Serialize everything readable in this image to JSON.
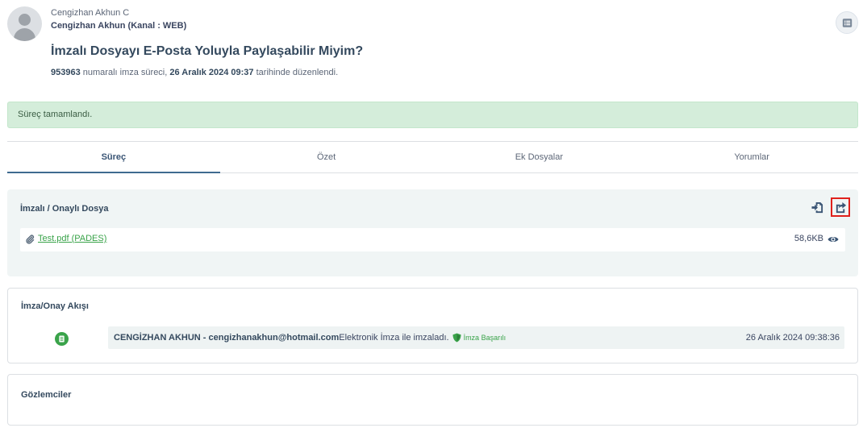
{
  "user": {
    "name": "Cengizhan Akhun C",
    "channel": "Cengizhan Akhun (Kanal : WEB)"
  },
  "title": "İmzalı Dosyayı E-Posta Yoluyla Paylaşabilir Miyim?",
  "meta": {
    "process_id": "953963",
    "text1": " numaralı imza süreci, ",
    "date": "26 Aralık 2024 09:37",
    "text2": " tarihinde düzenlendi."
  },
  "alert": "Süreç tamamlandı.",
  "tabs": [
    {
      "label": "Süreç"
    },
    {
      "label": "Özet"
    },
    {
      "label": "Ek Dosyalar"
    },
    {
      "label": "Yorumlar"
    }
  ],
  "signed_file": {
    "title": "İmzalı / Onaylı Dosya",
    "file_name": "Test.pdf (PADES)",
    "file_size": "58,6KB"
  },
  "flow": {
    "title": "İmza/Onay Akışı",
    "signer": "CENGİZHAN AKHUN - cengizhanakhun@hotmail.com",
    "action": " Elektronik İmza ile imzaladı.",
    "status": "İmza Başarılı",
    "date": "26 Aralık 2024 09:38:36"
  },
  "observers": {
    "title": "Gözlemciler"
  },
  "icons": {
    "menu": "list-icon",
    "download": "file-download-icon",
    "share": "share-icon",
    "attachment": "paperclip-icon",
    "view": "eye-icon",
    "step": "document-icon",
    "status": "shield-icon"
  },
  "colors": {
    "success": "#3aa34a",
    "alert_bg": "#d4edda",
    "highlight": "#e0211c",
    "tab_active": "#3f6a90"
  }
}
